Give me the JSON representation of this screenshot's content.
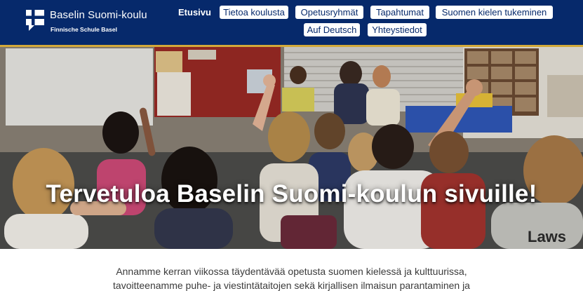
{
  "header": {
    "site_title": "Baselin Suomi-koulu",
    "site_subtitle": "Finnische Schule Basel",
    "logo_icon": "finnish-flag-speech-bubble-icon",
    "background": "#06296b",
    "accent_strip": "#d2a93a"
  },
  "nav": {
    "active": "Etusivu",
    "items": [
      "Tietoa koulusta",
      "Opetusryhmät",
      "Tapahtumat",
      "Suomen kielen tukeminen",
      "Auf Deutsch",
      "Yhteystiedot"
    ]
  },
  "hero": {
    "title": "Tervetuloa Baselin Suomi-koulun sivuille!",
    "image": "classroom-children-raising-hands-photo",
    "garment_text": "Laws"
  },
  "intro": {
    "lines": [
      "Annamme kerran viikossa täydentävää opetusta suomen kielessä ja kulttuurissa,",
      "tavoitteenamme puhe- ja viestintätaitojen sekä kirjallisen ilmaisun parantaminen ja"
    ]
  }
}
